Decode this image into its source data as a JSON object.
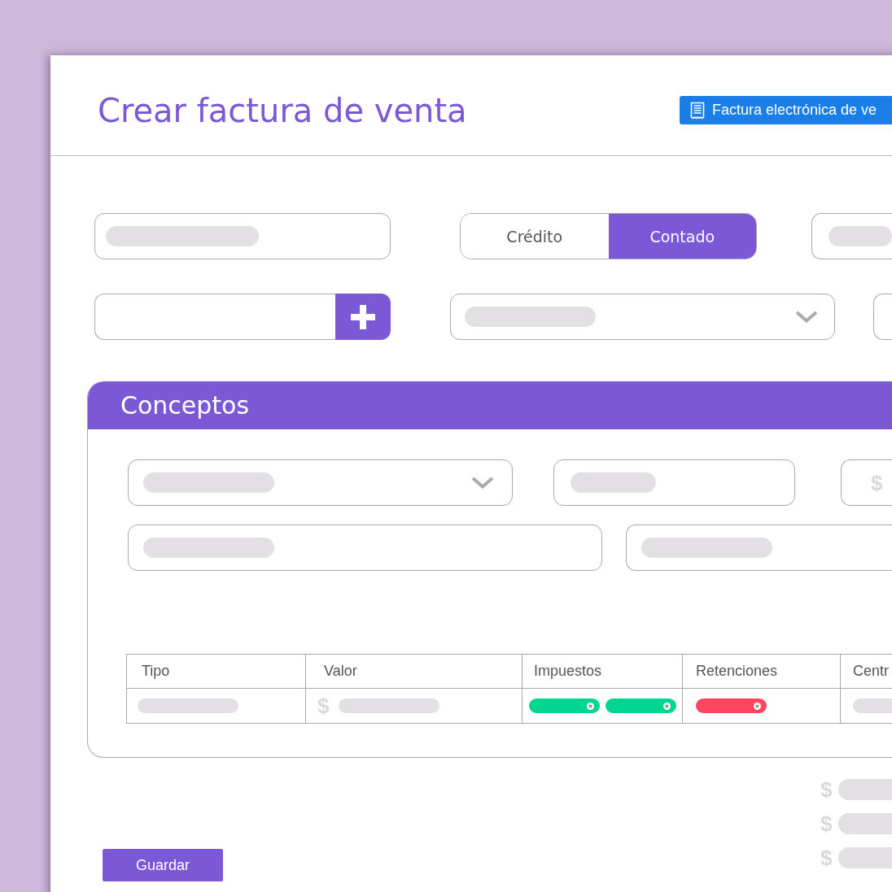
{
  "header": {
    "title": "Crear factura de venta",
    "badge": "Factura electrónica de ve"
  },
  "form_rows": [
    {
      "fields": [
        {
          "kind": "text"
        },
        {
          "kind": "toggle",
          "options": [
            {
              "label": "Crédito",
              "selected": false
            },
            {
              "label": "Contado",
              "selected": true
            }
          ]
        },
        {
          "kind": "text"
        }
      ]
    },
    {
      "fields": [
        {
          "kind": "add"
        },
        {
          "kind": "select"
        },
        {
          "kind": "blank"
        }
      ]
    }
  ],
  "concepts": {
    "title": "Conceptos",
    "rows": [
      {
        "fields": [
          {
            "kind": "select"
          },
          {
            "kind": "text"
          },
          {
            "kind": "currency",
            "prefix": "$"
          }
        ]
      },
      {
        "fields": [
          {
            "kind": "text"
          },
          {
            "kind": "text"
          }
        ]
      }
    ],
    "table": {
      "columns": [
        "Tipo",
        "Valor",
        "Impuestos",
        "Retenciones",
        "Centr"
      ],
      "rows": [
        {
          "cells": [
            {
              "kind": "bar"
            },
            {
              "kind": "currency",
              "prefix": "$"
            },
            {
              "kind": "chips",
              "chips": [
                {
                  "color": "#00d68f"
                },
                {
                  "color": "#00d68f"
                }
              ]
            },
            {
              "kind": "chips",
              "chips": [
                {
                  "color": "#ff4560"
                }
              ]
            },
            {
              "kind": "bar"
            }
          ]
        }
      ]
    }
  },
  "totals": [
    {
      "prefix": "$"
    },
    {
      "prefix": "$"
    },
    {
      "prefix": "$"
    }
  ],
  "save_button": "Guardar"
}
